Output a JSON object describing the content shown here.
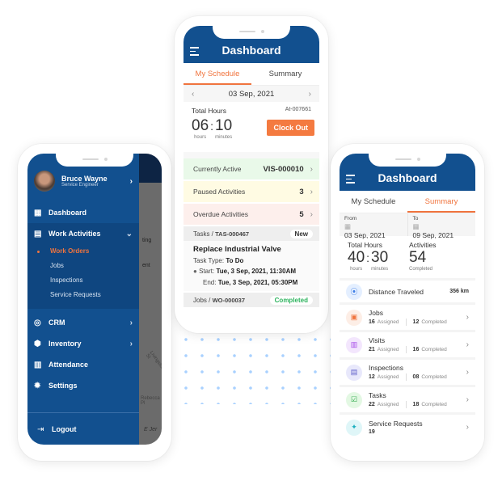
{
  "colors": {
    "primary": "#12508f",
    "accent": "#f0743e",
    "active_green": "#e9f9e9",
    "paused_yellow": "#fffbe3",
    "overdue_red": "#fdefec",
    "completed": "#2db35d"
  },
  "left_phone": {
    "profile": {
      "name": "Bruce Wayne",
      "role": "Service Engineer"
    },
    "nav": [
      {
        "label": "Dashboard",
        "icon": "dashboard-icon"
      },
      {
        "label": "Work Activities",
        "icon": "clipboard-icon",
        "expanded": true,
        "children": [
          "Work Orders",
          "Jobs",
          "Inspections",
          "Service Requests"
        ],
        "active_child": "Work Orders"
      },
      {
        "label": "CRM",
        "icon": "target-icon"
      },
      {
        "label": "Inventory",
        "icon": "box-icon"
      },
      {
        "label": "Attendance",
        "icon": "attendance-icon"
      },
      {
        "label": "Settings",
        "icon": "gear-icon"
      }
    ],
    "logout": "Logout",
    "bg_text": [
      "ting",
      "ent",
      "Livingston St",
      "Rebecca Pl",
      "E Jer"
    ]
  },
  "middle_phone": {
    "title": "Dashboard",
    "tabs": [
      "My Schedule",
      "Summary"
    ],
    "active_tab": "My Schedule",
    "date": "03 Sep, 2021",
    "total_hours_label": "Total Hours",
    "record_id": "At-007661",
    "hours": "06",
    "minutes": "10",
    "hours_unit": "hours",
    "minutes_unit": "minutes",
    "clock_out": "Clock Out",
    "activities": [
      {
        "label": "Currently Active",
        "value": "VIS-000010"
      },
      {
        "label": "Paused Activities",
        "value": "3"
      },
      {
        "label": "Overdue Activities",
        "value": "5"
      }
    ],
    "task": {
      "crumb": "Tasks /",
      "id": "TAS-000467",
      "status": "New",
      "title": "Replace Industrial Valve",
      "type_label": "Task Type:",
      "type": "To Do",
      "start_label": "Start:",
      "start": "Tue, 3 Sep, 2021, 11:30AM",
      "end_label": "End:",
      "end": "Tue, 3 Sep, 2021, 05:30PM"
    },
    "job": {
      "crumb": "Jobs /",
      "id": "WO-000037",
      "status": "Completed"
    }
  },
  "right_phone": {
    "title": "Dashboard",
    "tabs": [
      "My Schedule",
      "Summary"
    ],
    "active_tab": "Summary",
    "from_label": "From",
    "from": "03 Sep, 2021",
    "to_label": "To",
    "to": "09 Sep, 2021",
    "total_hours_label": "Total Hours",
    "hours": "40",
    "minutes": "30",
    "hours_unit": "hours",
    "minutes_unit": "minutes",
    "activities_label": "Activities",
    "activities": "54",
    "activities_unit": "Completed",
    "distance_label": "Distance Traveled",
    "distance": "356 km",
    "rows": [
      {
        "label": "Jobs",
        "assigned": "16",
        "completed": "12",
        "icon": "briefcase-icon"
      },
      {
        "label": "Visits",
        "assigned": "21",
        "completed": "16",
        "icon": "calendar-icon"
      },
      {
        "label": "Inspections",
        "assigned": "12",
        "completed": "08",
        "icon": "inspection-icon"
      },
      {
        "label": "Tasks",
        "assigned": "22",
        "completed": "18",
        "icon": "clipboard-check-icon"
      },
      {
        "label": "Service Requests",
        "assigned": "19",
        "completed": "",
        "icon": "service-icon"
      }
    ],
    "assigned_label": "Assigned",
    "completed_label": "Completed"
  }
}
